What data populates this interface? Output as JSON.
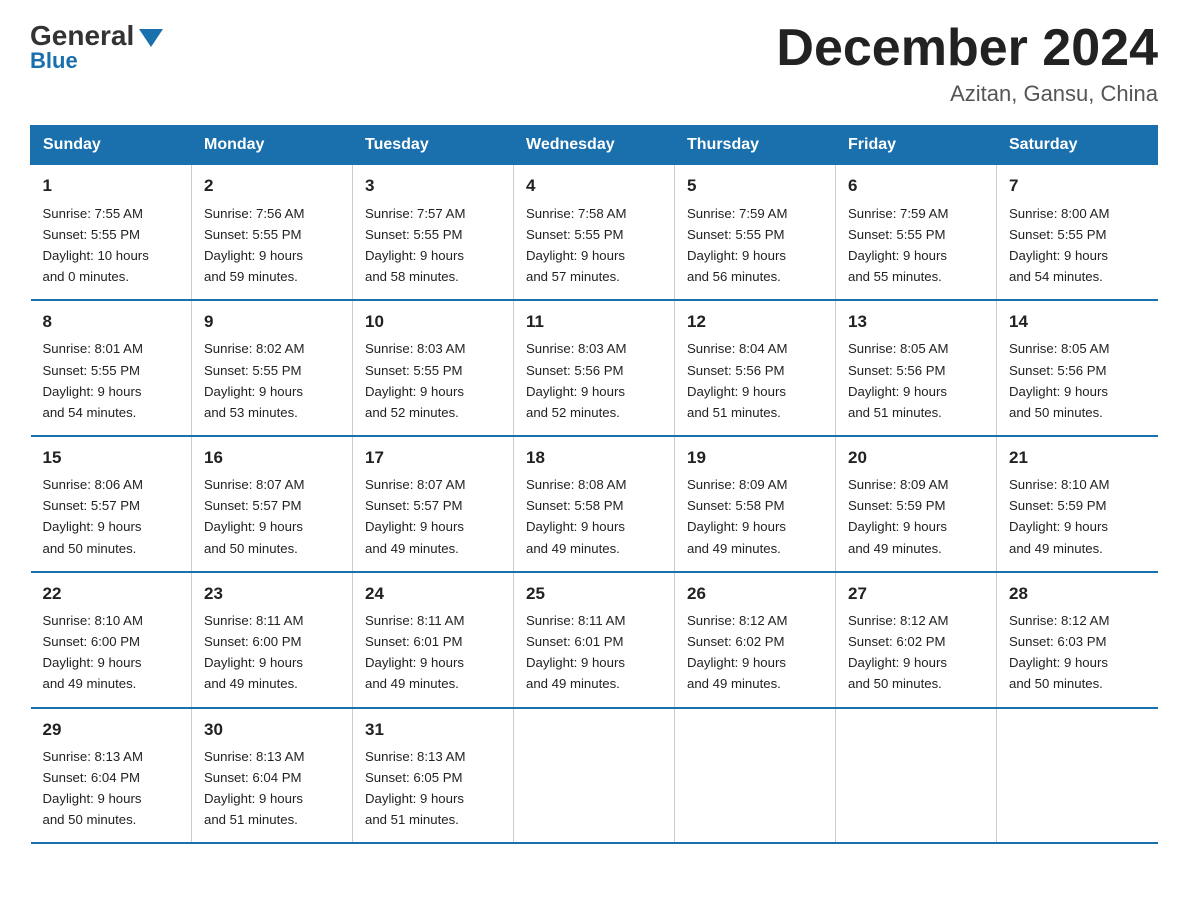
{
  "header": {
    "logo_general": "General",
    "logo_blue": "Blue",
    "month_title": "December 2024",
    "location": "Azitan, Gansu, China"
  },
  "days_of_week": [
    "Sunday",
    "Monday",
    "Tuesday",
    "Wednesday",
    "Thursday",
    "Friday",
    "Saturday"
  ],
  "weeks": [
    [
      {
        "day": "1",
        "sunrise": "7:55 AM",
        "sunset": "5:55 PM",
        "daylight": "10 hours and 0 minutes."
      },
      {
        "day": "2",
        "sunrise": "7:56 AM",
        "sunset": "5:55 PM",
        "daylight": "9 hours and 59 minutes."
      },
      {
        "day": "3",
        "sunrise": "7:57 AM",
        "sunset": "5:55 PM",
        "daylight": "9 hours and 58 minutes."
      },
      {
        "day": "4",
        "sunrise": "7:58 AM",
        "sunset": "5:55 PM",
        "daylight": "9 hours and 57 minutes."
      },
      {
        "day": "5",
        "sunrise": "7:59 AM",
        "sunset": "5:55 PM",
        "daylight": "9 hours and 56 minutes."
      },
      {
        "day": "6",
        "sunrise": "7:59 AM",
        "sunset": "5:55 PM",
        "daylight": "9 hours and 55 minutes."
      },
      {
        "day": "7",
        "sunrise": "8:00 AM",
        "sunset": "5:55 PM",
        "daylight": "9 hours and 54 minutes."
      }
    ],
    [
      {
        "day": "8",
        "sunrise": "8:01 AM",
        "sunset": "5:55 PM",
        "daylight": "9 hours and 54 minutes."
      },
      {
        "day": "9",
        "sunrise": "8:02 AM",
        "sunset": "5:55 PM",
        "daylight": "9 hours and 53 minutes."
      },
      {
        "day": "10",
        "sunrise": "8:03 AM",
        "sunset": "5:55 PM",
        "daylight": "9 hours and 52 minutes."
      },
      {
        "day": "11",
        "sunrise": "8:03 AM",
        "sunset": "5:56 PM",
        "daylight": "9 hours and 52 minutes."
      },
      {
        "day": "12",
        "sunrise": "8:04 AM",
        "sunset": "5:56 PM",
        "daylight": "9 hours and 51 minutes."
      },
      {
        "day": "13",
        "sunrise": "8:05 AM",
        "sunset": "5:56 PM",
        "daylight": "9 hours and 51 minutes."
      },
      {
        "day": "14",
        "sunrise": "8:05 AM",
        "sunset": "5:56 PM",
        "daylight": "9 hours and 50 minutes."
      }
    ],
    [
      {
        "day": "15",
        "sunrise": "8:06 AM",
        "sunset": "5:57 PM",
        "daylight": "9 hours and 50 minutes."
      },
      {
        "day": "16",
        "sunrise": "8:07 AM",
        "sunset": "5:57 PM",
        "daylight": "9 hours and 50 minutes."
      },
      {
        "day": "17",
        "sunrise": "8:07 AM",
        "sunset": "5:57 PM",
        "daylight": "9 hours and 49 minutes."
      },
      {
        "day": "18",
        "sunrise": "8:08 AM",
        "sunset": "5:58 PM",
        "daylight": "9 hours and 49 minutes."
      },
      {
        "day": "19",
        "sunrise": "8:09 AM",
        "sunset": "5:58 PM",
        "daylight": "9 hours and 49 minutes."
      },
      {
        "day": "20",
        "sunrise": "8:09 AM",
        "sunset": "5:59 PM",
        "daylight": "9 hours and 49 minutes."
      },
      {
        "day": "21",
        "sunrise": "8:10 AM",
        "sunset": "5:59 PM",
        "daylight": "9 hours and 49 minutes."
      }
    ],
    [
      {
        "day": "22",
        "sunrise": "8:10 AM",
        "sunset": "6:00 PM",
        "daylight": "9 hours and 49 minutes."
      },
      {
        "day": "23",
        "sunrise": "8:11 AM",
        "sunset": "6:00 PM",
        "daylight": "9 hours and 49 minutes."
      },
      {
        "day": "24",
        "sunrise": "8:11 AM",
        "sunset": "6:01 PM",
        "daylight": "9 hours and 49 minutes."
      },
      {
        "day": "25",
        "sunrise": "8:11 AM",
        "sunset": "6:01 PM",
        "daylight": "9 hours and 49 minutes."
      },
      {
        "day": "26",
        "sunrise": "8:12 AM",
        "sunset": "6:02 PM",
        "daylight": "9 hours and 49 minutes."
      },
      {
        "day": "27",
        "sunrise": "8:12 AM",
        "sunset": "6:02 PM",
        "daylight": "9 hours and 50 minutes."
      },
      {
        "day": "28",
        "sunrise": "8:12 AM",
        "sunset": "6:03 PM",
        "daylight": "9 hours and 50 minutes."
      }
    ],
    [
      {
        "day": "29",
        "sunrise": "8:13 AM",
        "sunset": "6:04 PM",
        "daylight": "9 hours and 50 minutes."
      },
      {
        "day": "30",
        "sunrise": "8:13 AM",
        "sunset": "6:04 PM",
        "daylight": "9 hours and 51 minutes."
      },
      {
        "day": "31",
        "sunrise": "8:13 AM",
        "sunset": "6:05 PM",
        "daylight": "9 hours and 51 minutes."
      },
      null,
      null,
      null,
      null
    ]
  ],
  "labels": {
    "sunrise": "Sunrise: ",
    "sunset": "Sunset: ",
    "daylight": "Daylight: "
  }
}
